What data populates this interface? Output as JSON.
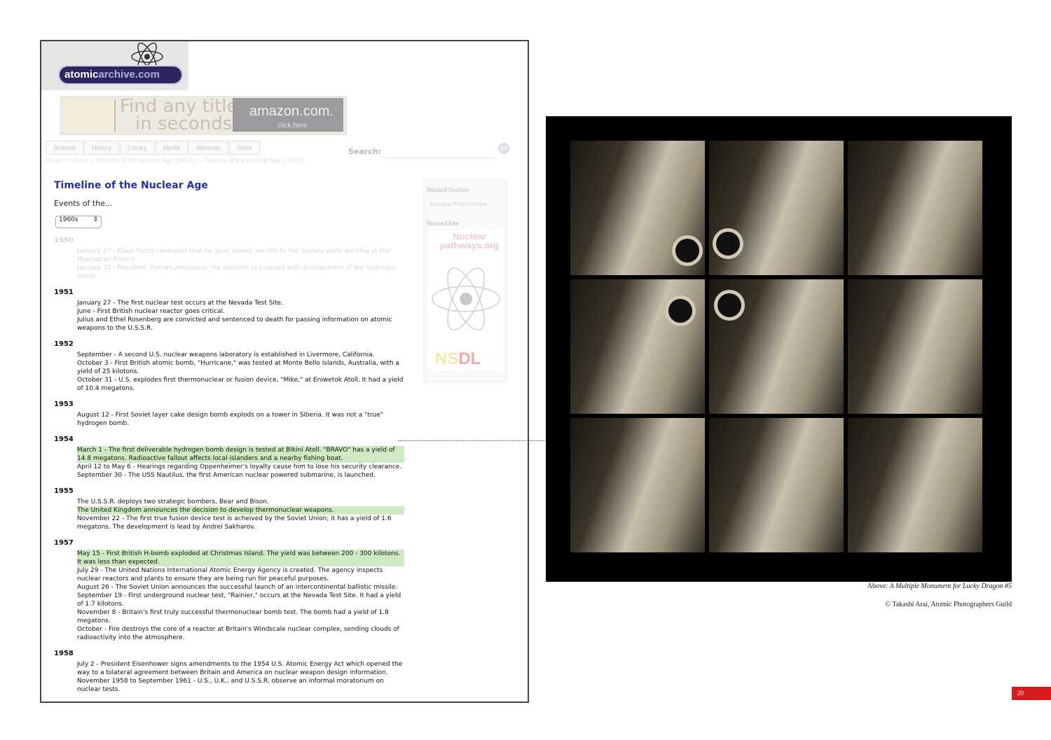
{
  "site": {
    "logo_main": "atomic",
    "logo_accent": "archive",
    "logo_tld": ".com",
    "banner_headline_1": "Find any title",
    "banner_headline_2": "in seconds.",
    "banner_brand": "amazon.com.",
    "banner_click": "click here",
    "tabs": [
      "Science",
      "History",
      "Library",
      "Media",
      "Almanac",
      "Store"
    ],
    "search_label": "Search:",
    "search_go": "go",
    "breadcrumb": "Home > Library > Timeline of the Nuclear Age (1950s) > Timeline of the Nuclear Age (1950s)"
  },
  "page": {
    "title": "Timeline of the Nuclear Age",
    "events_label": "Events of the...",
    "decade_selected": "1960s"
  },
  "timeline": [
    {
      "year": "1950",
      "faded": true,
      "events": [
        {
          "text": "January 27 - Klaus Fuchs confesses that he gave atomic secrets to the Soviets while working at the Manhattan Project.",
          "highlight": false
        },
        {
          "text": "January 31 - President Truman announces the decision to proceed with development of the hydrogen bomb.",
          "highlight": false
        }
      ]
    },
    {
      "year": "1951",
      "faded": false,
      "events": [
        {
          "text": "January 27 - The first nuclear test occurs at the Nevada Test Site.",
          "highlight": false
        },
        {
          "text": "June - First British nuclear reactor goes critical.",
          "highlight": false
        },
        {
          "text": "Julius and Ethel Rosenberg are convicted and sentenced to death for passing information on atomic weapons to the U.S.S.R.",
          "highlight": false
        }
      ]
    },
    {
      "year": "1952",
      "faded": false,
      "events": [
        {
          "text": "September - A second U.S. nuclear weapons laboratory is established in Livermore, California.",
          "highlight": false
        },
        {
          "text": "October 3 - First British atomic bomb, \"Hurricane,\" was tested at Monte Bello Islands, Australia, with a yield of 25 kilotons.",
          "highlight": false
        },
        {
          "text": "October 31 - U.S. explodes first thermonuclear or fusion device, \"Mike,\" at Eniwetok Atoll. It had a yield of 10.4 megatons.",
          "highlight": false
        }
      ]
    },
    {
      "year": "1953",
      "faded": false,
      "events": [
        {
          "text": "August 12 - First Soviet layer cake design bomb explods on a tower in Siberia. It was not a \"true\" hydrogen bomb.",
          "highlight": false
        }
      ]
    },
    {
      "year": "1954",
      "faded": false,
      "events": [
        {
          "text": "March 1 - The first deliverable hydrogen bomb design is tested at Bikini Atoll. \"BRAVO\" has a yield of 14.8 megatons. Radioactive fallout affects local islanders and a nearby fishing boat.",
          "highlight": true
        },
        {
          "text": "April 12 to May 6 - Hearings regarding Oppenheimer's loyalty cause him to lose his security clearance.",
          "highlight": false
        },
        {
          "text": "September 30 - The USS Nautilus, the first American nuclear powered submarine, is launched.",
          "highlight": false
        }
      ]
    },
    {
      "year": "1955",
      "faded": false,
      "events": [
        {
          "text": "The U.S.S.R. deploys two strategic bombers, Bear and Bison.",
          "highlight": false
        },
        {
          "text": "The United Kingdom announces the decision to develop thermonuclear weapons.",
          "highlight": true
        },
        {
          "text": "November 22 - The first true fusion device test is acheived by the Soviet Union; it has a yield of 1.6 megatons. The development is lead by Andrei Sakharov.",
          "highlight": false
        }
      ]
    },
    {
      "year": "1957",
      "faded": false,
      "events": [
        {
          "text": "May 15 - First British H-bomb exploded at Christmas Island. The yield was between 200 - 300 kilotons. It was less than expected.",
          "highlight": true
        },
        {
          "text": "July 29 - The United Nations International Atomic Energy Agency is created. The agency inspects nuclear reactors and plants to ensure they are being run for peaceful purposes.",
          "highlight": false
        },
        {
          "text": "August 26 - The Soviet Union announces the successful launch of an intercontinental ballistic missile.",
          "highlight": false
        },
        {
          "text": "September 19 - First underground nuclear test, \"Rainier,\" occurs at the Nevada Test Site. It had a yield of 1.7 kilotons.",
          "highlight": false
        },
        {
          "text": "November 8 - Britain's first truly successful thermonuclear bomb test. The bomb had a yield of 1.8 megatons.",
          "highlight": false
        },
        {
          "text": "October - Fire destroys the core of a reactor at Britain's Windscale nuclear complex, sending clouds of radioactivity into the atmosphere.",
          "highlight": false
        }
      ]
    },
    {
      "year": "1958",
      "faded": false,
      "events": [
        {
          "text": "July 2 - President Eisenhower signs amendments to the 1954 U.S. Atomic Energy Act which opened the way to a bilateral agreement between Britain and America on nuclear weapon design information.",
          "highlight": false
        },
        {
          "text": "November 1958 to September 1961 - U.S., U.K., and U.S.S.R. observe an informal moratorium on nuclear tests.",
          "highlight": false
        }
      ]
    }
  ],
  "sidebar": {
    "related_section_heading": "Related Section",
    "related_section_link": "Manhattan Project Archive",
    "related_site_heading": "Related Site",
    "related_site_title": "Nuclear pathways.org",
    "logo_text_1": "NS",
    "logo_text_2": "DL"
  },
  "caption": {
    "above_prefix": "Above:",
    "above_title": "A Multiple Monument for Lucky Dragon #5",
    "credit": "© Takashi Arai, Atomic Photographers Guild"
  },
  "page_number": "20",
  "colors": {
    "title_blue": "#23339b",
    "highlight_green": "#cfe9c3",
    "page_number_red": "#d51d1f",
    "logo_navy": "#2d2560"
  }
}
